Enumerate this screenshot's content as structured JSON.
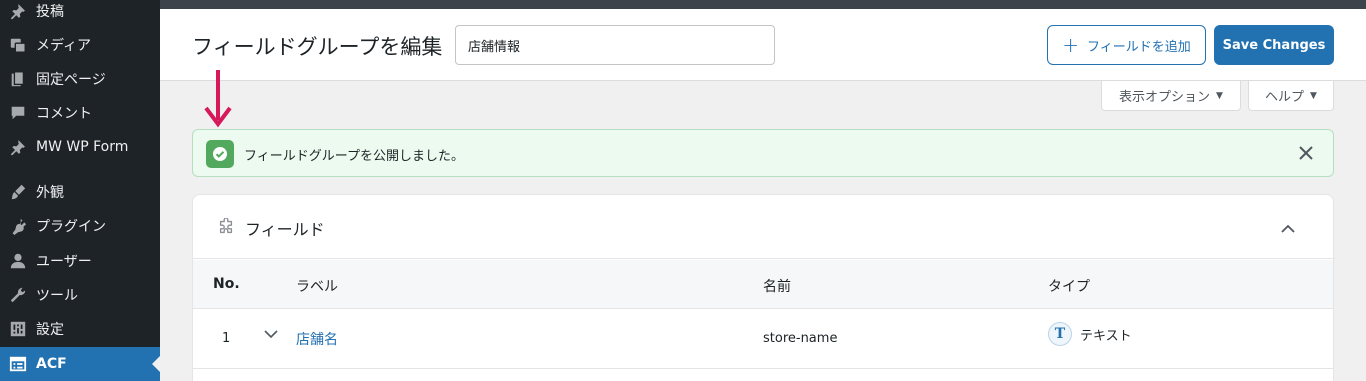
{
  "sidebar": {
    "items": [
      {
        "label": "投稿",
        "icon": "pin-icon"
      },
      {
        "label": "メディア",
        "icon": "media-icon"
      },
      {
        "label": "固定ページ",
        "icon": "page-icon"
      },
      {
        "label": "コメント",
        "icon": "comment-icon"
      },
      {
        "label": "MW WP Form",
        "icon": "pin-icon"
      },
      {
        "label": "外観",
        "icon": "brush-icon"
      },
      {
        "label": "プラグイン",
        "icon": "plugin-icon"
      },
      {
        "label": "ユーザー",
        "icon": "user-icon"
      },
      {
        "label": "ツール",
        "icon": "wrench-icon"
      },
      {
        "label": "設定",
        "icon": "settings-icon"
      },
      {
        "label": "ACF",
        "icon": "acf-icon",
        "active": true
      }
    ]
  },
  "header": {
    "title": "フィールドグループを編集",
    "title_input_value": "店舗情報",
    "add_field_label": "フィールドを追加",
    "save_label": "Save Changes"
  },
  "screen_meta": {
    "options_label": "表示オプション",
    "help_label": "ヘルプ"
  },
  "notice": {
    "text": "フィールドグループを公開しました。"
  },
  "fields_panel": {
    "title": "フィールド",
    "columns": {
      "no": "No.",
      "label": "ラベル",
      "name": "名前",
      "type": "タイプ"
    },
    "rows": [
      {
        "no": "1",
        "label": "店舗名",
        "name": "store-name",
        "type": "テキスト",
        "type_icon": "T"
      }
    ]
  },
  "colors": {
    "sidebar_bg": "#1d2327",
    "accent": "#2271b1",
    "notice_bg": "#edfaef",
    "arrow": "#d6195a"
  }
}
